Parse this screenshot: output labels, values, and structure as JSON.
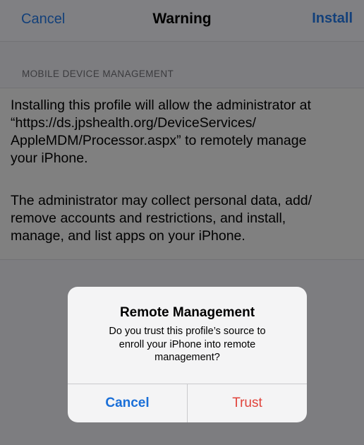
{
  "navbar": {
    "cancel_label": "Cancel",
    "title": "Warning",
    "install_label": "Install"
  },
  "section": {
    "header": "MOBILE DEVICE MANAGEMENT",
    "paragraph1_lines": [
      "Installing this profile will allow the administrator at",
      "“https://ds.jpshealth.org/DeviceServices/",
      "AppleMDM/Processor.aspx” to remotely manage",
      "your iPhone."
    ],
    "paragraph2_lines": [
      "The administrator may collect personal data, add/",
      "remove accounts and restrictions, and install,",
      "manage, and list apps on your iPhone."
    ]
  },
  "alert": {
    "title": "Remote Management",
    "message_lines": [
      "Do you trust this profile’s source to",
      "enroll your iPhone into remote",
      "management?"
    ],
    "cancel_label": "Cancel",
    "trust_label": "Trust"
  },
  "colors": {
    "accent_blue": "#1a6fd8",
    "destructive_red": "#e0433b",
    "dimmed_link": "#13407a"
  }
}
